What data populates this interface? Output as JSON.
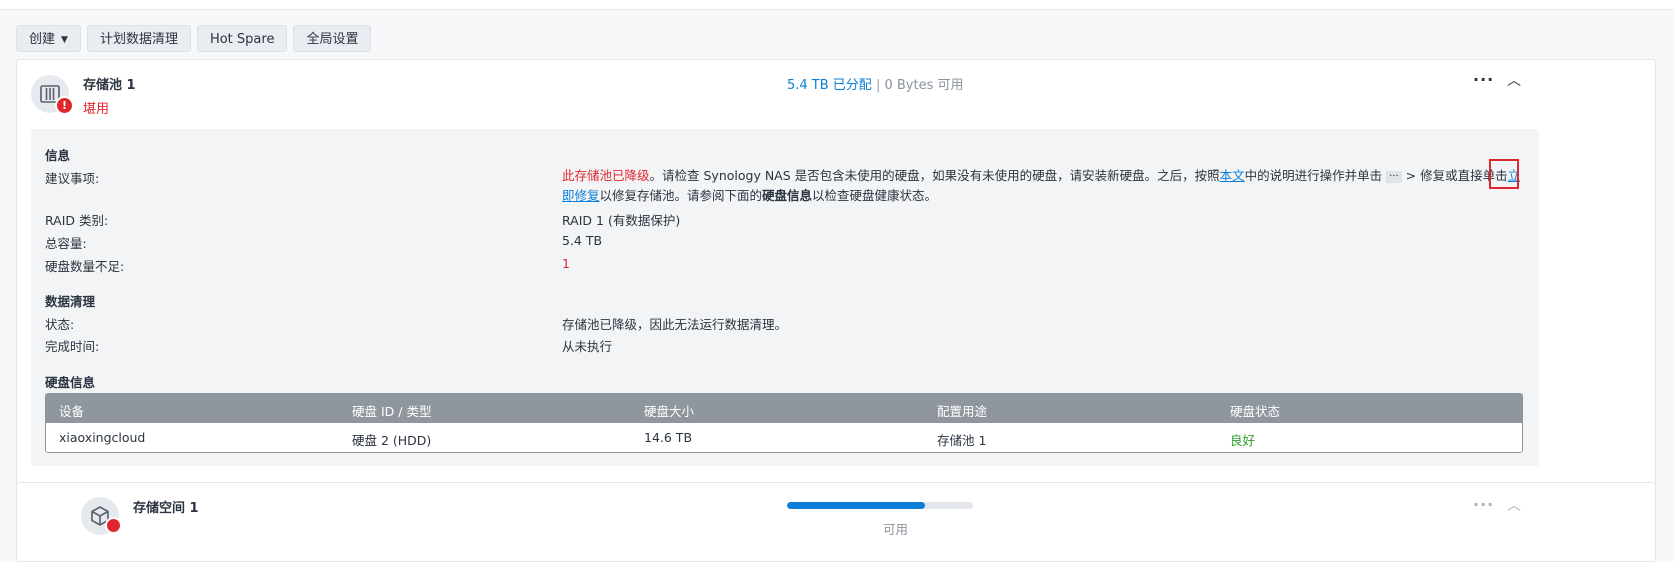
{
  "toolbar": {
    "create_label": "创建",
    "schedule_scrub_label": "计划数据清理",
    "hot_spare_label": "Hot Spare",
    "global_settings_label": "全局设置"
  },
  "pool": {
    "title": "存储池 1",
    "status": "堪用",
    "allocated": "5.4 TB 已分配",
    "separator": "|",
    "available": "0 Bytes 可用",
    "more_icon": "more-icon",
    "collapse_icon": "chevron-up-icon",
    "info": {
      "section_title": "信息",
      "advice_label": "建议事项:",
      "advice": {
        "degraded": "此存储池已降级",
        "part1": "。请检查 Synology NAS 是否包含未使用的硬盘，如果没有未使用的硬盘，请安装新硬盘。之后，按照",
        "link_article": "本文",
        "part2": "中的说明进行操作并单击",
        "dots": "···",
        "part3": " > 修复或直接单击",
        "link_repair": "立即修复",
        "part4": "以修复存储池。请参阅下面的",
        "bold_disk_info": "硬盘信息",
        "part5": "以检查硬盘健康状态。"
      },
      "raid_label": "RAID 类别:",
      "raid_value": "RAID 1 (有数据保护)",
      "capacity_label": "总容量:",
      "capacity_value": "5.4 TB",
      "missing_label": "硬盘数量不足:",
      "missing_value": "1"
    },
    "scrub": {
      "section_title": "数据清理",
      "status_label": "状态:",
      "status_value": "存储池已降级，因此无法运行数据清理。",
      "completed_label": "完成时间:",
      "completed_value": "从未执行"
    },
    "disks": {
      "section_title": "硬盘信息",
      "headers": [
        "设备",
        "硬盘 ID / 类型",
        "硬盘大小",
        "配置用途",
        "硬盘状态"
      ],
      "rows": [
        [
          "xiaoxingcloud",
          "硬盘 2 (HDD)",
          "14.6 TB",
          "存储池 1",
          "良好"
        ]
      ]
    }
  },
  "volume": {
    "title": "存储空间 1",
    "usage_fraction": 0.74,
    "available_partial": "可用"
  },
  "colors": {
    "accent": "#0c7fd8",
    "error": "#e0262d",
    "ok": "#2ca02c"
  }
}
